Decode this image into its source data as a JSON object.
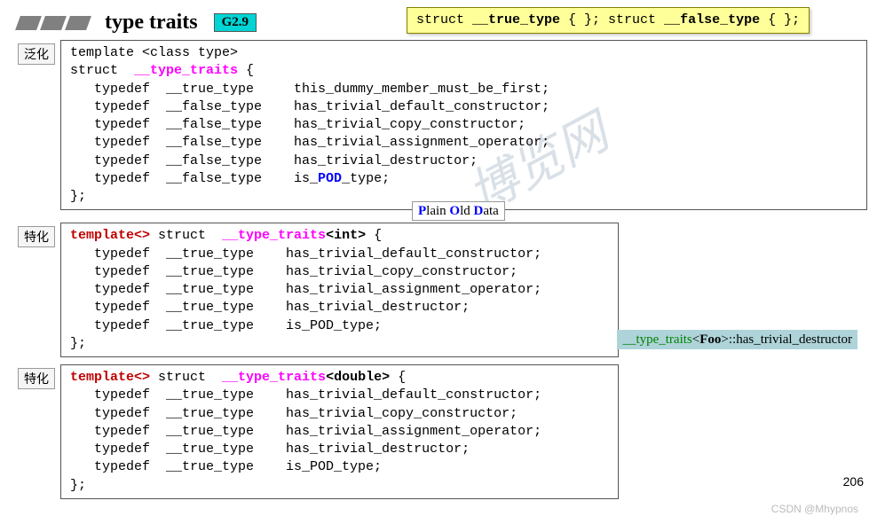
{
  "header": {
    "title": "type traits",
    "badge": "G2.9"
  },
  "yellow": {
    "line1": "struct  __true_type { };",
    "line2": "struct  __false_type { };",
    "true_label": "true_type",
    "false_label": "false_type"
  },
  "pod": {
    "p": "P",
    "lain": "lain ",
    "o": "O",
    "ld": "ld ",
    "d": "D",
    "ata": "ata"
  },
  "block1": {
    "tag": "泛化",
    "body_head": "template <class type>\nstruct  ",
    "tt": "__type_traits",
    "body_open": " {\n   typedef  __true_type     this_dummy_member_must_be_first;\n   typedef  __false_type    has_trivial_default_constructor;\n   typedef  __false_type    has_trivial_copy_constructor;\n   typedef  __false_type    has_trivial_assignment_operator;\n   typedef  __false_type    has_trivial_destructor;\n   typedef  __false_type    is_",
    "pod": "POD",
    "body_close": "_type;\n};"
  },
  "block2": {
    "tag": "特化",
    "tpl": "template<>",
    "mid": " struct  ",
    "tt": "__type_traits",
    "ang_open": "<",
    "spec": "int",
    "ang_close": ">",
    "body": " {\n   typedef  __true_type    has_trivial_default_constructor;\n   typedef  __true_type    has_trivial_copy_constructor;\n   typedef  __true_type    has_trivial_assignment_operator;\n   typedef  __true_type    has_trivial_destructor;\n   typedef  __true_type    is_POD_type;\n};"
  },
  "block3": {
    "tag": "特化",
    "tpl": "template<>",
    "mid": " struct  ",
    "tt": "__type_traits",
    "ang_open": "<",
    "spec": "double",
    "ang_close": ">",
    "body": " {\n   typedef  __true_type    has_trivial_default_constructor;\n   typedef  __true_type    has_trivial_copy_constructor;\n   typedef  __true_type    has_trivial_assignment_operator;\n   typedef  __true_type    has_trivial_destructor;\n   typedef  __true_type    is_POD_type;\n};"
  },
  "example": {
    "tt": "__type_traits",
    "open": "<",
    "foo": "Foo",
    "close": ">::has_trivial_destructor"
  },
  "page": "206",
  "wm_bottom": "CSDN @Mhypnos",
  "wm_center": "博览网"
}
